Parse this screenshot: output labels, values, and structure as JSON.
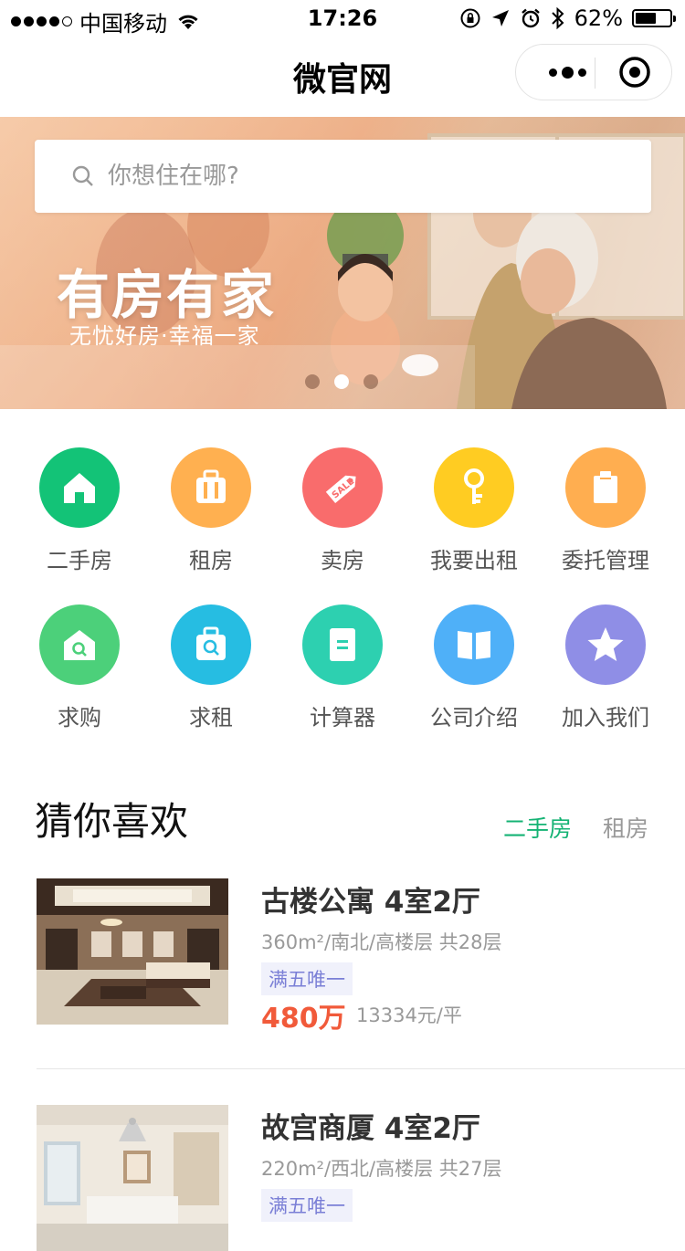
{
  "status_bar": {
    "carrier": "中国移动",
    "time": "17:26",
    "battery": "62%",
    "battery_level": 0.62
  },
  "nav": {
    "title": "微官网"
  },
  "banner": {
    "search_placeholder": "你想住在哪?",
    "headline": "有房有家",
    "subline": "无忧好房·幸福一家",
    "slide_count": 3,
    "active_slide": 2
  },
  "grid": {
    "items": [
      {
        "label": "二手房",
        "icon": "house-icon",
        "color": "#13c377"
      },
      {
        "label": "租房",
        "icon": "suitcase-icon",
        "color": "#ffb050"
      },
      {
        "label": "卖房",
        "icon": "sale-tag-icon",
        "color": "#f96c6c"
      },
      {
        "label": "我要出租",
        "icon": "key-icon",
        "color": "#ffcc22"
      },
      {
        "label": "委托管理",
        "icon": "clipboard-icon",
        "color": "#ffae50"
      },
      {
        "label": "求购",
        "icon": "house-search-icon",
        "color": "#4cd07a"
      },
      {
        "label": "求租",
        "icon": "suitcase-search-icon",
        "color": "#26bde2"
      },
      {
        "label": "计算器",
        "icon": "calculator-icon",
        "color": "#2dd0b0"
      },
      {
        "label": "公司介绍",
        "icon": "book-icon",
        "color": "#4fb0f8"
      },
      {
        "label": "加入我们",
        "icon": "star-icon",
        "color": "#8f8ee6"
      }
    ]
  },
  "section": {
    "title": "猜你喜欢",
    "tabs": [
      "二手房",
      "租房"
    ],
    "active_tab": 0
  },
  "listings": [
    {
      "title": "古楼公寓 4室2厅",
      "meta": "360m²/南北/高楼层 共28层",
      "tag": "满五唯一",
      "price": "480万",
      "unit_price": "13334元/平"
    },
    {
      "title": "故宫商厦 4室2厅",
      "meta": "220m²/西北/高楼层 共27层",
      "tag": "满五唯一"
    }
  ]
}
